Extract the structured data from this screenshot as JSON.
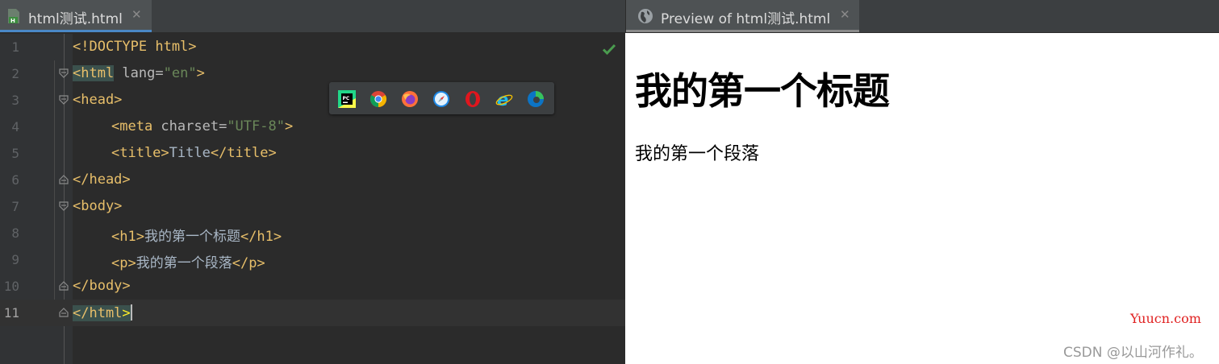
{
  "editor": {
    "tab_label": "html测试.html",
    "close_glyph": "✕",
    "file_icon": "html-file-icon",
    "status_icon": "check-icon",
    "lines": [
      {
        "num": "1"
      },
      {
        "num": "2"
      },
      {
        "num": "3"
      },
      {
        "num": "4"
      },
      {
        "num": "5"
      },
      {
        "num": "6"
      },
      {
        "num": "7"
      },
      {
        "num": "8"
      },
      {
        "num": "9"
      },
      {
        "num": "10"
      },
      {
        "num": "11"
      }
    ],
    "code": {
      "l1": "<!DOCTYPE html>",
      "l2_tag": "<html",
      "l2_attr": " lang=",
      "l2_val": "\"en\"",
      "l2_end": ">",
      "l3": "<head>",
      "l4_tag": "<meta",
      "l4_attr": " charset=",
      "l4_val": "\"UTF-8\"",
      "l4_end": ">",
      "l5_open": "<title>",
      "l5_text": "Title",
      "l5_close": "</title>",
      "l6": "</head>",
      "l7": "<body>",
      "l8_open": "<h1>",
      "l8_text": "我的第一个标题",
      "l8_close": "</h1>",
      "l9_open": "<p>",
      "l9_text": "我的第一个段落",
      "l9_close": "</p>",
      "l10": "</body>",
      "l11_a": "</html",
      "l11_b": ">"
    }
  },
  "browser_bar": {
    "icons": [
      "pycharm-icon",
      "chrome-icon",
      "firefox-icon",
      "safari-icon",
      "opera-icon",
      "ie-icon",
      "edge-icon"
    ]
  },
  "preview": {
    "tab_label": "Preview of html测试.html",
    "close_glyph": "✕",
    "tab_icon": "globe-icon",
    "heading": "我的第一个标题",
    "paragraph": "我的第一个段落",
    "watermark_site": "Yuucn.com",
    "watermark_author": "CSDN @以山河作礼。"
  },
  "colors": {
    "editor_bg": "#2b2b2b",
    "tag": "#e8bf6a",
    "string": "#6a8759",
    "text": "#a9b7c6",
    "tab_underline": "#4a88c7"
  }
}
